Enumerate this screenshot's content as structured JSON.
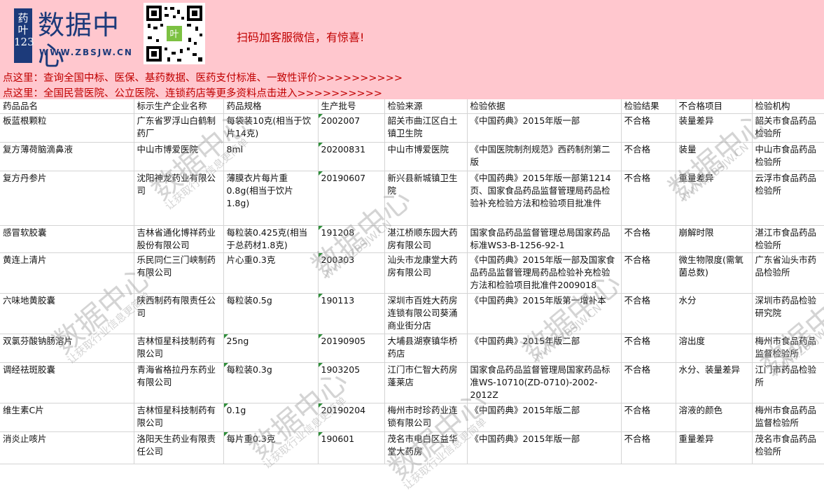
{
  "banner": {
    "logo_badge": "药叶123",
    "logo_name": "数据中心",
    "logo_url": "WWW.ZBSJW.CN",
    "promo": "扫码加客服微信，有惊喜!",
    "link1": "点这里：查询全国中标、医保、基药数据、医药支付标准、一致性评价>>>>>>>>>>",
    "link2": "点这里：全国民营医院、公立医院、连锁药店等更多资料点击进入>>>>>>>>>>"
  },
  "watermark": {
    "text": "数据中心",
    "sub": "让获取行业信息更简单",
    "url": "WWW.ZBSJW.CN"
  },
  "columns": [
    "药品品名",
    "标示生产企业名称",
    "药品规格",
    "生产批号",
    "检验来源",
    "检验依据",
    "检验结果",
    "不合格项目",
    "检验机构"
  ],
  "rows": [
    [
      "板蓝根颗粒",
      "广东省罗浮山白鹤制药厂",
      "每袋装10克(相当于饮片14克)",
      "2002007",
      "韶关市曲江区白土镇卫生院",
      "《中国药典》2015年版一部",
      "不合格",
      "装量差异",
      "韶关市食品药品检验所"
    ],
    [
      "复方薄荷脑滴鼻液",
      "中山市博爱医院",
      "8ml",
      "20200831",
      "中山市博爱医院",
      "《中国医院制剂规范》西药制剂第二版",
      "不合格",
      "装量",
      "中山市食品药品检验所"
    ],
    [
      "复方丹参片",
      "沈阳神龙药业有限公司",
      "薄膜衣片每片重0.8g(相当于饮片1.8g)",
      "20190607",
      "新兴县新城镇卫生院",
      "《中国药典》2015年版一部第1214页、国家食品药品监督管理局药品检验补充检验方法和检验项目批准件",
      "不合格",
      "重量差异",
      "云浮市食品药品检验所"
    ],
    [
      "感冒软胶囊",
      "吉林省通化博祥药业股份有限公司",
      "每粒装0.425克(相当于总药材1.8克)",
      "191208",
      "湛江桥顺东园大药房有限公司",
      "国家食品药品监督管理总局国家药品标准WS3-B-1256-92-1",
      "不合格",
      "崩解时限",
      "湛江市食品药品检验所"
    ],
    [
      "黄连上清片",
      "乐民同仁三门峡制药有限公司",
      "片心重0.3克",
      "200303",
      "汕头市龙康堂大药房有限公司",
      "《中国药典》2015年版一部及国家食品药品监督管理局药品检验补充检验方法和检验项目批准件2009018",
      "不合格",
      "微生物限度(需氧菌总数)",
      "广东省汕头市药品检验所"
    ],
    [
      "六味地黄胶囊",
      "陕西制药有限责任公司",
      "每粒装0.5g",
      "190113",
      "深圳市百姓大药房连锁有限公司葵涌商业街分店",
      "《中国药典》2015年版第一增补本",
      "不合格",
      "水分",
      "深圳市药品检验研究院"
    ],
    [
      "双氯芬酸钠肠溶片",
      "吉林恒星科技制药有限公司",
      "25ng",
      "20190905",
      "大埔县湖寮镇华桥药店",
      "《中国药典》2015年版二部",
      "不合格",
      "溶出度",
      "梅州市食品药品监督检验所"
    ],
    [
      "调经祛斑胶囊",
      "青海省格拉丹东药业有限公司",
      "每粒装0.3g",
      "1903205",
      "江门市仁智大药房蓬莱店",
      "国家食品药品监督管理局国家药品标准WS-10710(ZD-0710)-2002-2012Z",
      "不合格",
      "水分、装量差异",
      "江门市药品检验所"
    ],
    [
      "维生素C片",
      "吉林恒星科技制药有限公司",
      "0.1g",
      "20190204",
      "梅州市时珍药业连锁有限公司",
      "《中国药典》2015年版二部",
      "不合格",
      "溶液的颜色",
      "梅州市食品药品监督检验所"
    ],
    [
      "消炎止咳片",
      "洛阳天生药业有限责任公司",
      "每片重0.3克",
      "190601",
      "茂名市电白区益华堂大药房",
      "《中国药典》2015年版一部",
      "不合格",
      "重量差异",
      "茂名市食品药品检验所"
    ]
  ]
}
